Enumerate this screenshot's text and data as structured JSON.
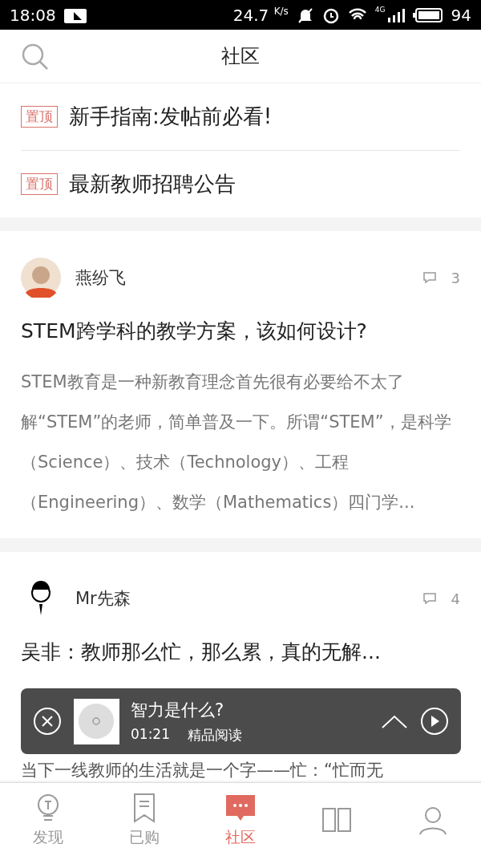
{
  "status_bar": {
    "time": "18:08",
    "speed": "24.7",
    "speed_unit": "K/s",
    "network": "4G",
    "battery": "94"
  },
  "header": {
    "title": "社区"
  },
  "pinned": [
    {
      "tag": "置顶",
      "title": "新手指南:发帖前必看!"
    },
    {
      "tag": "置顶",
      "title": "最新教师招聘公告"
    }
  ],
  "posts": [
    {
      "author": "燕纷飞",
      "comments": "3",
      "title": "STEM跨学科的教学方案，该如何设计?",
      "body": "STEM教育是一种新教育理念首先很有必要给不太了解“STEM”的老师，简单普及一下。所谓“STEM”，是科学（Science）、技术（Technology）、工程（Engineering）、数学（Mathematics）四门学..."
    },
    {
      "author": "Mr先森",
      "comments": "4",
      "title": "吴非：教师那么忙，那么累，真的无解...",
      "body": "当下一线教师的生活就是一个字——忙：“忙而无"
    }
  ],
  "player": {
    "title": "智力是什么?",
    "time": "01:21",
    "source": "精品阅读"
  },
  "nav": [
    {
      "kind": "bulb",
      "label": "发现",
      "selected": false
    },
    {
      "kind": "bookmark",
      "label": "已购",
      "selected": false
    },
    {
      "kind": "chat",
      "label": "社区",
      "selected": true
    },
    {
      "kind": "grid",
      "selected": false
    },
    {
      "kind": "person",
      "selected": false
    }
  ]
}
